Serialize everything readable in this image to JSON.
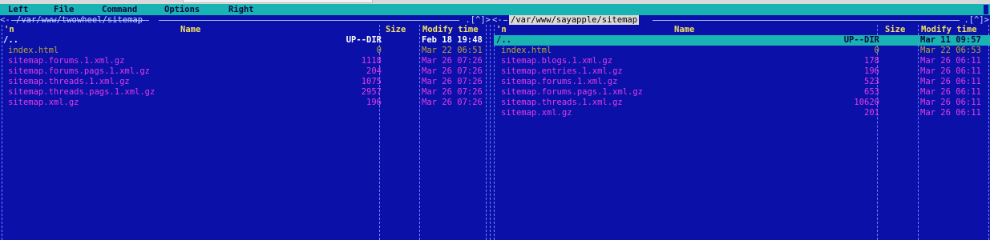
{
  "menu": {
    "items": [
      "Left",
      "File",
      "Command",
      "Options",
      "Right"
    ]
  },
  "left_panel": {
    "path": "/var/www/twowheel/sitemap",
    "arrow": "<-",
    "corner": ".[^]>",
    "columns": {
      "n": "'n",
      "name": "Name",
      "size": "Size",
      "mtime": "Modify time"
    },
    "rows": [
      {
        "name": "/..",
        "size": "UP--DIR",
        "mtime": "Feb 18 19:48",
        "kind": "updir"
      },
      {
        "name": "index.html",
        "size": "0",
        "mtime": "Mar 22 06:51",
        "kind": "plain"
      },
      {
        "name": "sitemap.forums.1.xml.gz",
        "size": "1118",
        "mtime": "Mar 26 07:26",
        "kind": "arch"
      },
      {
        "name": "sitemap.forums.pags.1.xml.gz",
        "size": "204",
        "mtime": "Mar 26 07:26",
        "kind": "arch"
      },
      {
        "name": "sitemap.threads.1.xml.gz",
        "size": "1075",
        "mtime": "Mar 26 07:26",
        "kind": "arch"
      },
      {
        "name": "sitemap.threads.pags.1.xml.gz",
        "size": "2957",
        "mtime": "Mar 26 07:26",
        "kind": "arch"
      },
      {
        "name": "sitemap.xml.gz",
        "size": "196",
        "mtime": "Mar 26 07:26",
        "kind": "arch"
      }
    ]
  },
  "right_panel": {
    "path": "/var/www/sayapple/sitemap",
    "arrow": "<-",
    "corner": ".[^]>",
    "columns": {
      "n": "'n",
      "name": "Name",
      "size": "Size",
      "mtime": "Modify time"
    },
    "rows": [
      {
        "name": "/..",
        "size": "UP--DIR",
        "mtime": "Mar 11 09:57",
        "kind": "updir",
        "selected": true
      },
      {
        "name": "index.html",
        "size": "0",
        "mtime": "Mar 22 06:53",
        "kind": "plain"
      },
      {
        "name": "sitemap.blogs.1.xml.gz",
        "size": "178",
        "mtime": "Mar 26 06:11",
        "kind": "arch"
      },
      {
        "name": "sitemap.entries.1.xml.gz",
        "size": "196",
        "mtime": "Mar 26 06:11",
        "kind": "arch"
      },
      {
        "name": "sitemap.forums.1.xml.gz",
        "size": "523",
        "mtime": "Mar 26 06:11",
        "kind": "arch"
      },
      {
        "name": "sitemap.forums.pags.1.xml.gz",
        "size": "653",
        "mtime": "Mar 26 06:11",
        "kind": "arch"
      },
      {
        "name": "sitemap.threads.1.xml.gz",
        "size": "10620",
        "mtime": "Mar 26 06:11",
        "kind": "arch"
      },
      {
        "name": "sitemap.xml.gz",
        "size": "201",
        "mtime": "Mar 26 06:11",
        "kind": "arch"
      }
    ]
  }
}
